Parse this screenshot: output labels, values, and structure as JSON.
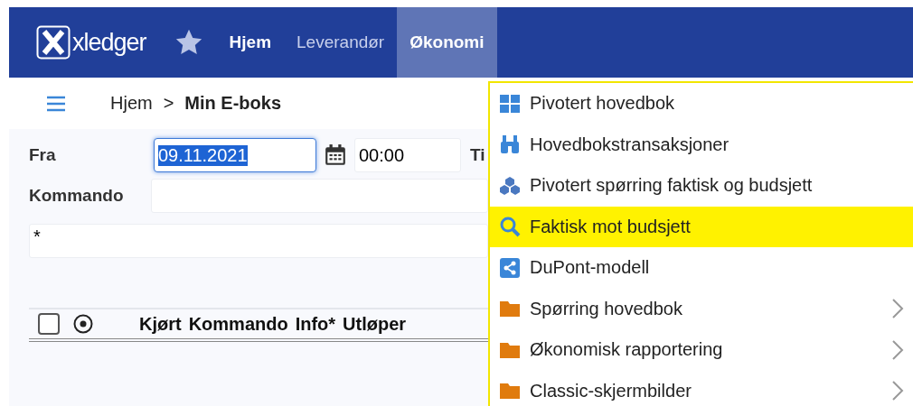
{
  "topbar": {
    "logo": "xledger",
    "nav": [
      {
        "label": "Hjem",
        "bold": true,
        "selected": false
      },
      {
        "label": "Leverandør",
        "bold": false,
        "selected": false
      },
      {
        "label": "Økonomi",
        "bold": true,
        "selected": true
      }
    ]
  },
  "breadcrumb": {
    "items": [
      "Hjem",
      "Min E-boks"
    ],
    "separator": ">"
  },
  "form": {
    "from_label": "Fra",
    "date": "09.11.2021",
    "date_selected": true,
    "time": "00:00",
    "to_label": "Ti",
    "command_label": "Kommando",
    "filter": "*"
  },
  "table": {
    "select_all": {
      "checked": false
    },
    "columns": [
      "Kjørt",
      "Kommando",
      "Info*",
      "Utløper"
    ]
  },
  "menu": {
    "items": [
      {
        "label": "Pivotert hovedbok",
        "kind": "grid",
        "submenu": false,
        "selected": false
      },
      {
        "label": "Hovedbokstransaksjoner",
        "kind": "binoculars",
        "submenu": false,
        "selected": false
      },
      {
        "label": "Pivotert spørring faktisk og budsjett",
        "kind": "cubes",
        "submenu": false,
        "selected": false
      },
      {
        "label": "Faktisk mot budsjett",
        "kind": "search",
        "submenu": false,
        "selected": true
      },
      {
        "label": "DuPont-modell",
        "kind": "share",
        "submenu": false,
        "selected": false
      },
      {
        "label": "Spørring hovedbok",
        "kind": "folder",
        "submenu": true,
        "selected": false
      },
      {
        "label": "Økonomisk rapportering",
        "kind": "folder",
        "submenu": true,
        "selected": false
      },
      {
        "label": "Classic-skjermbilder",
        "kind": "folder",
        "submenu": true,
        "selected": false
      }
    ]
  }
}
